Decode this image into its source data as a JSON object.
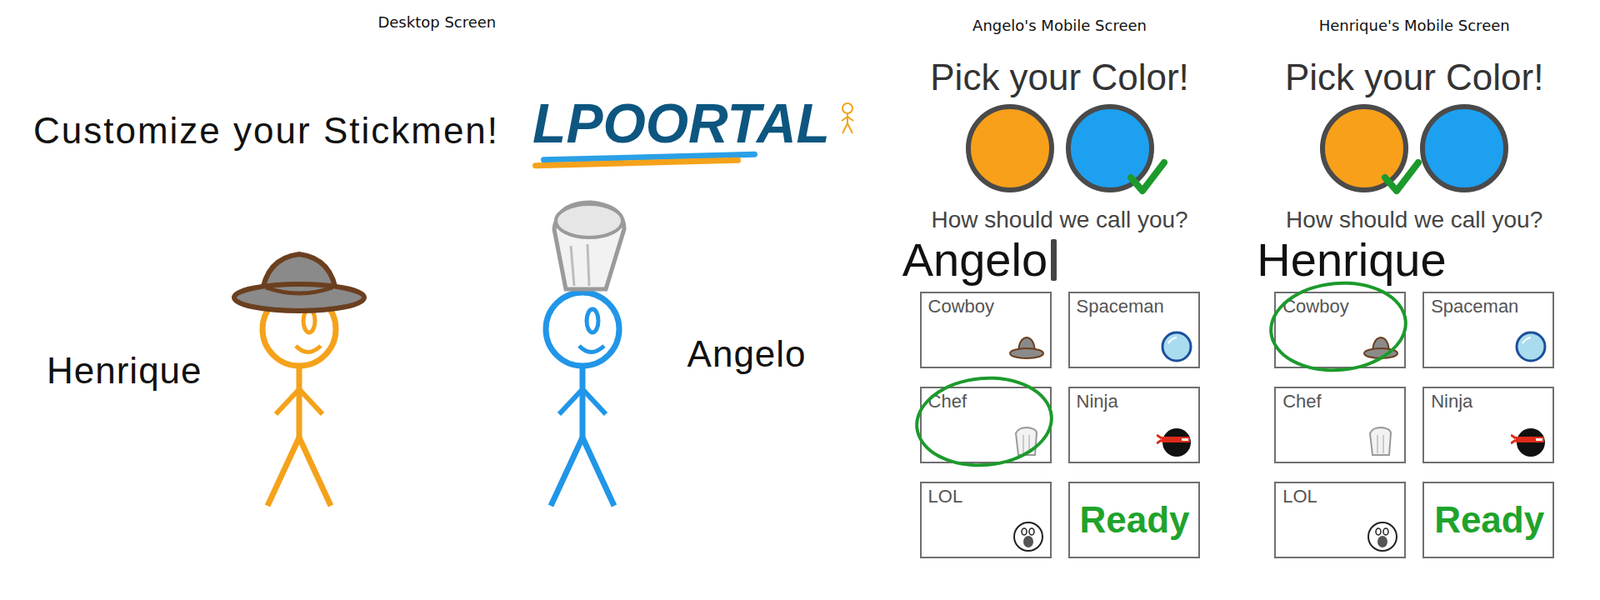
{
  "desktop": {
    "label": "Desktop Screen",
    "heading": "Customize your Stickmen!",
    "logo": "LPOORTAL",
    "players": [
      {
        "name": "Henrique",
        "color": "#f5a21b",
        "hat": "cowboy"
      },
      {
        "name": "Angelo",
        "color": "#2196e8",
        "hat": "chef"
      }
    ]
  },
  "mobiles": [
    {
      "label": "Angelo's Mobile Screen",
      "title": "Pick your Color!",
      "colors": [
        {
          "color": "#f8a01a",
          "selected": false
        },
        {
          "color": "#1ea0f0",
          "selected": true
        }
      ],
      "prompt": "How should we call you?",
      "name": "Angelo",
      "caret": true,
      "options": [
        {
          "label": "Cowboy",
          "kind": "cowboy",
          "selected": false
        },
        {
          "label": "Spaceman",
          "kind": "spaceman",
          "selected": false
        },
        {
          "label": "Chef",
          "kind": "chef",
          "selected": true
        },
        {
          "label": "Ninja",
          "kind": "ninja",
          "selected": false
        },
        {
          "label": "LOL",
          "kind": "lol",
          "selected": false
        }
      ],
      "ready": "Ready"
    },
    {
      "label": "Henrique's Mobile Screen",
      "title": "Pick your Color!",
      "colors": [
        {
          "color": "#f8a01a",
          "selected": true
        },
        {
          "color": "#1ea0f0",
          "selected": false
        }
      ],
      "prompt": "How should we call you?",
      "name": "Henrique",
      "caret": false,
      "options": [
        {
          "label": "Cowboy",
          "kind": "cowboy",
          "selected": true
        },
        {
          "label": "Spaceman",
          "kind": "spaceman",
          "selected": false
        },
        {
          "label": "Chef",
          "kind": "chef",
          "selected": false
        },
        {
          "label": "Ninja",
          "kind": "ninja",
          "selected": false
        },
        {
          "label": "LOL",
          "kind": "lol",
          "selected": false
        }
      ],
      "ready": "Ready"
    }
  ]
}
